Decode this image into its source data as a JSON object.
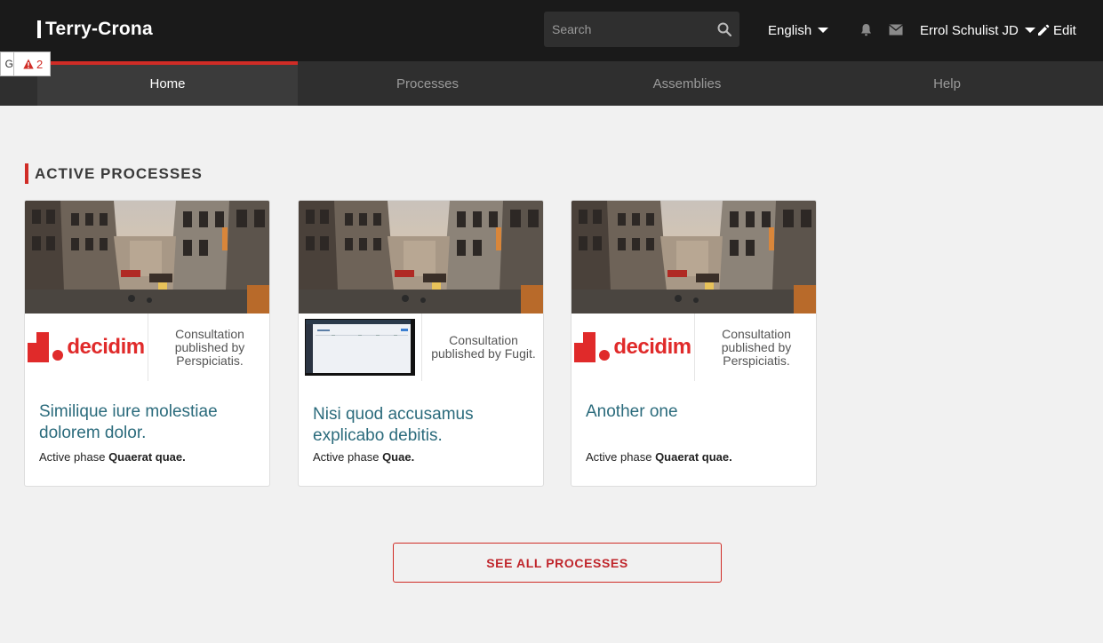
{
  "header": {
    "brand": "Terry-Crona",
    "search": {
      "placeholder": "Search",
      "value": ""
    },
    "language": "English",
    "user": "Errol Schulist JD",
    "edit_label": "Edit",
    "icons": [
      "search-icon",
      "bell-icon",
      "mail-icon",
      "pencil-icon"
    ]
  },
  "badges": {
    "left_char": "G",
    "alert_count": "2"
  },
  "nav": {
    "items": [
      {
        "label": "Home",
        "active": true
      },
      {
        "label": "Processes",
        "active": false
      },
      {
        "label": "Assemblies",
        "active": false
      },
      {
        "label": "Help",
        "active": false
      }
    ]
  },
  "section": {
    "title": "ACTIVE PROCESSES"
  },
  "cards": [
    {
      "logo": "decidim",
      "logo_text": "decidim",
      "meta": "Consultation published by Perspiciatis.",
      "title": "Similique iure molestiae dolorem dolor.",
      "phase_prefix": "Active phase",
      "phase": "Quaerat quae."
    },
    {
      "logo": "screenshot",
      "meta": "Consultation published by Fugit.",
      "title": "Nisi quod accusamus explicabo debitis.",
      "phase_prefix": "Active phase",
      "phase": "Quae."
    },
    {
      "logo": "decidim",
      "logo_text": "decidim",
      "meta": "Consultation published by Perspiciatis.",
      "title": "Another one",
      "phase_prefix": "Active phase",
      "phase": "Quaerat quae."
    }
  ],
  "see_all_label": "SEE ALL PROCESSES",
  "colors": {
    "accent": "#d02c26",
    "topbar": "#1a1a1a",
    "nav": "#2f2f2f",
    "title_link": "#2b6b7c"
  }
}
